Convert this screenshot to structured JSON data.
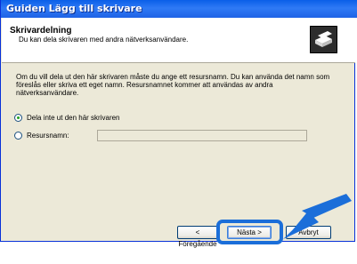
{
  "window": {
    "title": "Guiden Lägg till skrivare"
  },
  "header": {
    "title": "Skrivardelning",
    "subtitle": "Du kan dela skrivaren med andra nätverksanvändare.",
    "icon": "printer-icon"
  },
  "main": {
    "description": "Om du vill dela ut den här skrivaren måste du ange ett resursnamn. Du kan använda det namn som föreslås eller skriva ett eget namn. Resursnamnet kommer att användas av andra nätverksanvändare.",
    "option_no_share": "Dela inte ut den här skrivaren",
    "option_share": "Resursnamn:",
    "share_name_value": "",
    "selected_option": "option_no_share"
  },
  "buttons": {
    "back": "< Föregående",
    "next": "Nästa >",
    "cancel": "Avbryt"
  },
  "colors": {
    "title_bar": "#1f63e6",
    "highlight": "#1b6ed9",
    "arrow": "#1b6ed9"
  }
}
